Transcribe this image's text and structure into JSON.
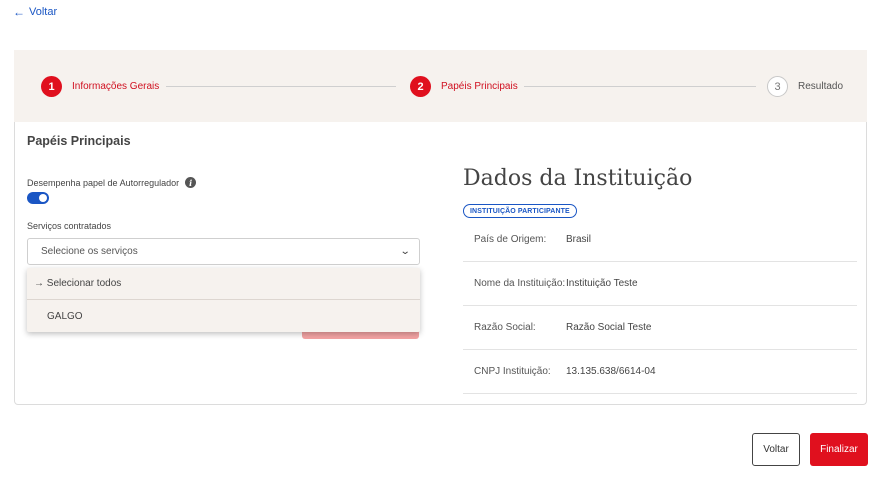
{
  "nav": {
    "back_label": "Voltar",
    "back_icon": "arrow-left-icon"
  },
  "stepper": {
    "steps": [
      {
        "number": "1",
        "label": "Informações Gerais",
        "state": "active"
      },
      {
        "number": "2",
        "label": "Papéis Principais",
        "state": "active"
      },
      {
        "number": "3",
        "label": "Resultado",
        "state": "inactive"
      }
    ]
  },
  "form": {
    "title": "Papéis Principais",
    "autoregulador_label": "Desempenha papel de Autorregulador",
    "autoregulador_enabled": true,
    "services_label": "Serviços contratados",
    "services_placeholder": "Selecione os serviços",
    "dropdown": {
      "select_all_label": "→ Selecionar todos",
      "options": [
        "GALGO"
      ]
    }
  },
  "institution": {
    "title": "Dados da Instituição",
    "badge": "INSTITUIÇÃO PARTICIPANTE",
    "rows": [
      {
        "key": "País de Origem:",
        "value": "Brasil"
      },
      {
        "key": "Nome da Instituição:",
        "value": "Instituição Teste"
      },
      {
        "key": "Razão Social:",
        "value": "Razão Social Teste"
      },
      {
        "key": "CNPJ Instituição:",
        "value": "13.135.638/6614-04"
      }
    ]
  },
  "footer": {
    "back_button": "Voltar",
    "finish_button": "Finalizar"
  },
  "colors": {
    "primary_red": "#e0101e",
    "link_blue": "#1a56c4",
    "stepper_bg": "#f6f2ee"
  }
}
